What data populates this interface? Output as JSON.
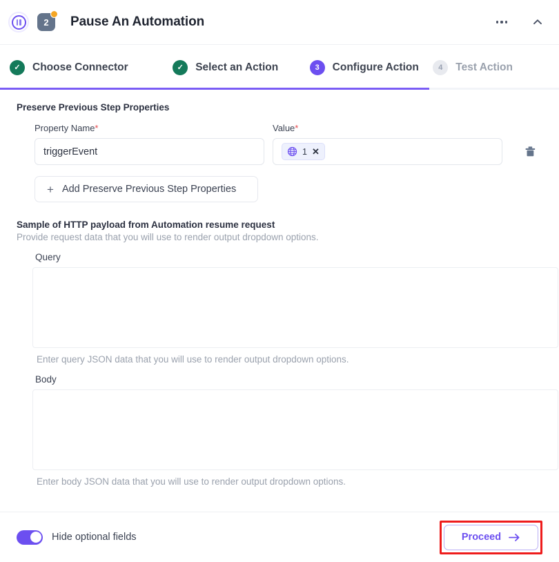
{
  "header": {
    "pause_icon": "pause-circle-icon",
    "step_number": "2",
    "badge_icon": "notification-dot",
    "title": "Pause An Automation",
    "more_icon": "ellipsis-icon",
    "collapse_icon": "chevron-up-icon"
  },
  "stepper": {
    "steps": [
      {
        "mark": "✓",
        "label": "Choose Connector",
        "state": "done"
      },
      {
        "mark": "✓",
        "label": "Select an Action",
        "state": "done"
      },
      {
        "mark": "3",
        "label": "Configure Action",
        "state": "active"
      },
      {
        "mark": "4",
        "label": "Test Action",
        "state": "todo"
      }
    ],
    "progress_color": "#7a5cf5"
  },
  "main": {
    "preserve_section": {
      "title": "Preserve Previous Step Properties",
      "property_name_label": "Property Name",
      "property_name_value": "triggerEvent",
      "property_name_placeholder": "",
      "value_label": "Value",
      "value_chip": {
        "icon": "globe-icon",
        "text": "1",
        "remove": "✕"
      },
      "required_mark": "*",
      "delete_icon": "trash-icon",
      "add_button_label": "Add Preserve Previous Step Properties",
      "add_button_icon": "+"
    },
    "sample_section": {
      "title": "Sample of HTTP payload from Automation resume request",
      "subtitle": "Provide request data that you will use to render output dropdown options.",
      "query_label": "Query",
      "query_value": "",
      "query_placeholder": "",
      "query_help": "Enter query JSON data that you will use to render output dropdown options.",
      "body_label": "Body",
      "body_value": "",
      "body_placeholder": "",
      "body_help": "Enter body JSON data that you will use to render output dropdown options."
    }
  },
  "footer": {
    "toggle_label": "Hide optional fields",
    "toggle_on": true,
    "proceed_label": "Proceed",
    "proceed_icon": "arrow-right-icon",
    "highlight_color": "#ee1c1c"
  }
}
